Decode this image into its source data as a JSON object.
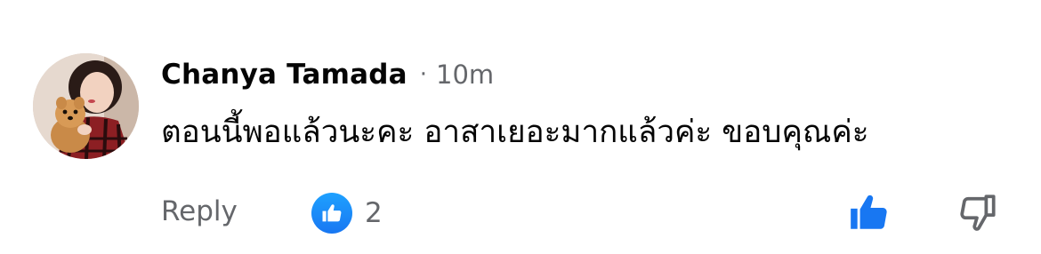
{
  "comment": {
    "author": "Chanya Tamada",
    "separator": "·",
    "timestamp": "10m",
    "text": "ตอนนี้พอแล้วนะคะ อาสาเยอะมากแล้วค่ะ ขอบคุณค่ะ",
    "reply_label": "Reply",
    "like_count": "2",
    "icons": {
      "reaction": "like-icon",
      "upvote": "thumbs-up-icon",
      "downvote": "thumbs-down-icon"
    },
    "colors": {
      "accent": "#1877F2",
      "secondary_text": "#65676B",
      "primary_text": "#050505"
    }
  }
}
